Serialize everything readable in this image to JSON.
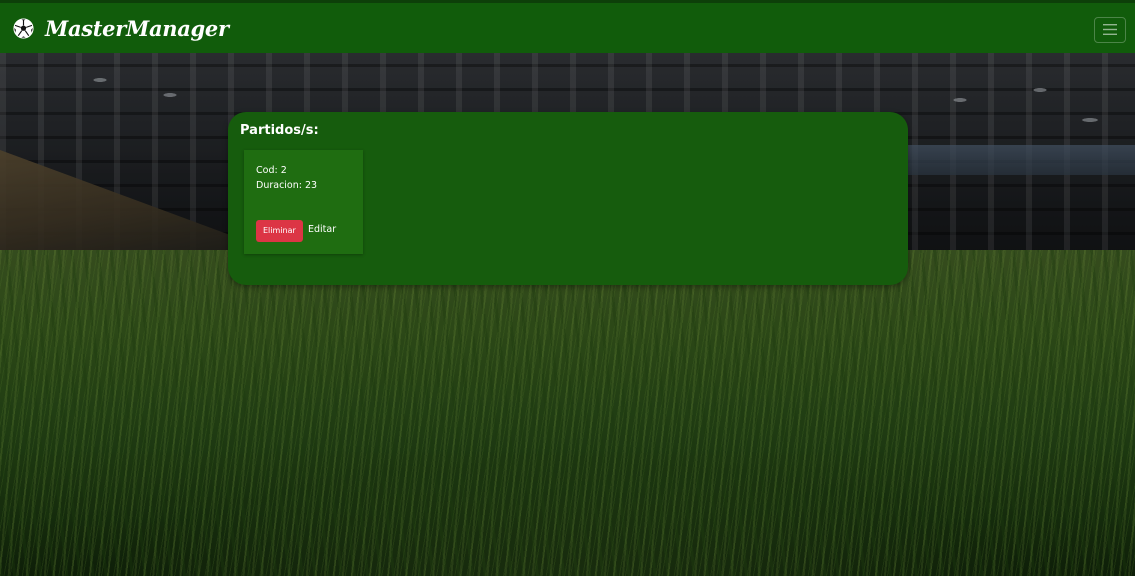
{
  "navbar": {
    "brand": "MasterManager",
    "brand_icon": "soccer-ball-icon",
    "menu_icon": "hamburger-icon",
    "bg_color": "#115c0b"
  },
  "main": {
    "title": "Partidos/s:",
    "matches": [
      {
        "cod_text": "Cod: 2",
        "duration_text": "Duracion: 23",
        "delete_label": "Eliminar",
        "edit_label": "Editar"
      }
    ]
  },
  "colors": {
    "panel": "#165c0d",
    "card": "#1f6d11",
    "delete_button": "#dc3545"
  }
}
